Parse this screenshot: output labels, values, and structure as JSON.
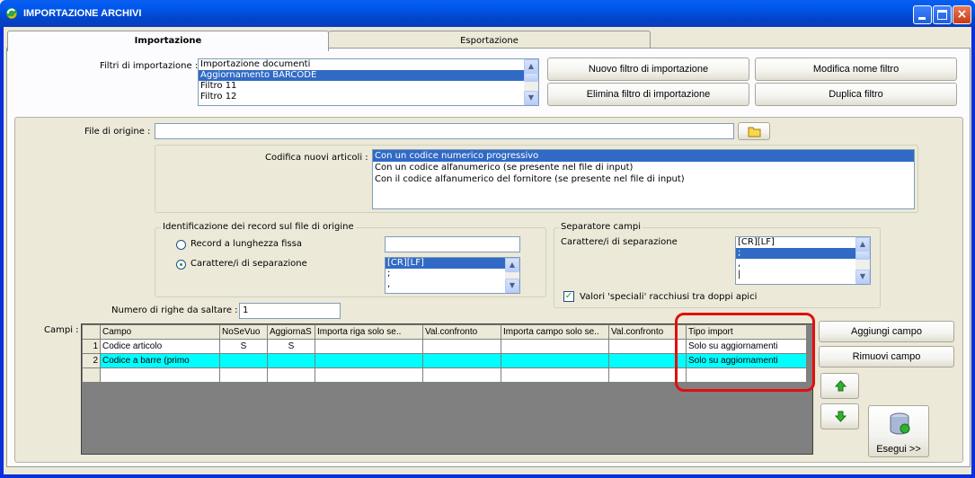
{
  "window": {
    "title": "IMPORTAZIONE ARCHIVI"
  },
  "tabs": {
    "import": "Importazione",
    "export": "Esportazione"
  },
  "filters": {
    "label": "Filtri di importazione :",
    "items": [
      "Importazione documenti",
      "Aggiornamento BARCODE",
      "Filtro 11",
      "Filtro 12"
    ],
    "selected_index": 1
  },
  "buttons": {
    "new_filter": "Nuovo filtro di importazione",
    "rename_filter": "Modifica nome filtro",
    "delete_filter": "Elimina filtro di importazione",
    "duplicate_filter": "Duplica filtro",
    "add_field": "Aggiungi campo",
    "remove_field": "Rimuovi campo",
    "execute": "Esegui >>"
  },
  "source": {
    "label": "File di origine :",
    "value": ""
  },
  "coding": {
    "label": "Codifica nuovi articoli :",
    "options": [
      "Con un codice numerico progressivo",
      "Con un codice alfanumerico (se presente nel file di input)",
      "Con il codice alfanumerico del fornitore (se presente nel file di input)"
    ],
    "selected_index": 0
  },
  "record_id": {
    "title": "Identificazione dei record sul file di origine",
    "fixed_label": "Record a lunghezza fissa",
    "fixed_value": "",
    "sep_label": "Carattere/i di separazione",
    "sep_items": [
      "[CR][LF]",
      ";",
      ","
    ],
    "sep_selected": 0,
    "selected": "sep"
  },
  "field_sep": {
    "title": "Separatore campi",
    "label": "Carattere/i di separazione",
    "items": [
      "[CR][LF]",
      ";",
      ",",
      "|"
    ],
    "selected_index": 1,
    "quotes_label": "Valori 'speciali' racchiusi tra doppi apici",
    "quotes_checked": true
  },
  "skip": {
    "label": "Numero di righe da saltare  :",
    "value": "1"
  },
  "fields": {
    "label": "Campi :",
    "columns": [
      "Campo",
      "NoSeVuo",
      "AggiornaS",
      "Importa riga solo se..",
      "Val.confronto",
      "Importa campo solo se..",
      "Val.confronto",
      "Tipo import"
    ],
    "rows": [
      [
        "1",
        "Codice articolo",
        "S",
        "S",
        "",
        "",
        "",
        "",
        "Solo su aggiornamenti"
      ],
      [
        "2",
        "Codice a barre (primo",
        "",
        "",
        "",
        "",
        "",
        "",
        "Solo su aggiornamenti"
      ],
      [
        "",
        "",
        "",
        "",
        "",
        "",
        "",
        "",
        ""
      ]
    ],
    "highlight_color": "#00ffff"
  },
  "colors": {
    "title_bar": "#0058ee",
    "highlight_outline": "#e01010",
    "selection": "#316ac5"
  }
}
